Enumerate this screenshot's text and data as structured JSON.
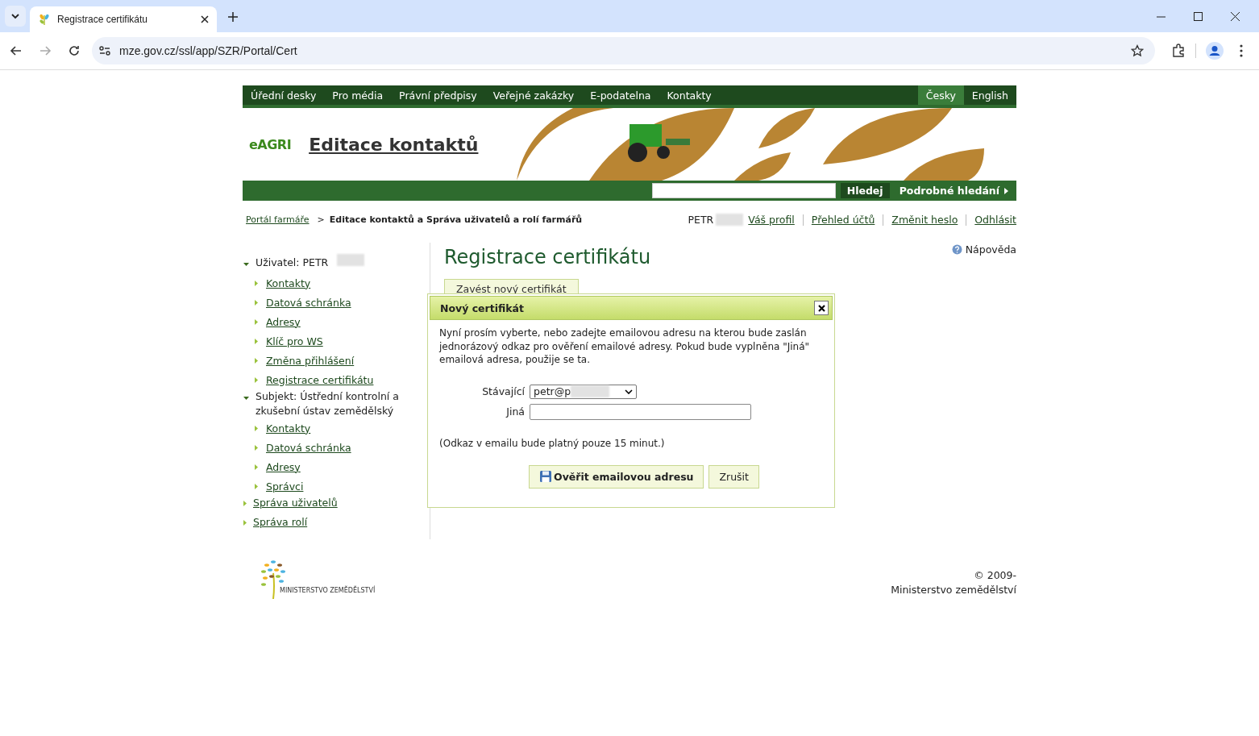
{
  "browser": {
    "tab_title": "Registrace certifikátu",
    "url": "mze.gov.cz/ssl/app/SZR/Portal/Cert"
  },
  "top_nav": [
    "Úřední desky",
    "Pro média",
    "Právní předpisy",
    "Veřejné zakázky",
    "E-podatelna",
    "Kontakty"
  ],
  "languages": [
    {
      "label": "Česky",
      "selected": true
    },
    {
      "label": "English",
      "selected": false
    }
  ],
  "header": {
    "logo": "eAGRI",
    "title": "Editace kontaktů"
  },
  "search": {
    "button": "Hledej",
    "advanced": "Podrobné hledání"
  },
  "breadcrumb_separator": ">",
  "breadcrumb": [
    {
      "label": "Portál farmáře",
      "link": true
    },
    {
      "label": "Editace kontaktů a Správa uživatelů a rolí farmářů",
      "link": false
    }
  ],
  "user_name": "PETR",
  "user_links": [
    "Váš profil",
    "Přehled účtů",
    "Změnit heslo",
    "Odhlásit"
  ],
  "sidebar": {
    "items": [
      {
        "label": "Uživatel: PETR",
        "kind": "header",
        "expanded": true,
        "redacted": true,
        "children": [
          {
            "label": "Kontakty"
          },
          {
            "label": "Datová schránka"
          },
          {
            "label": "Adresy"
          },
          {
            "label": "Klíč pro WS"
          },
          {
            "label": "Změna přihlášení"
          },
          {
            "label": "Registrace certifikátu"
          }
        ]
      },
      {
        "label": "Subjekt: Ústřední kontrolní a zkušební ústav zemědělský",
        "kind": "header",
        "expanded": true,
        "redacted": false,
        "children": [
          {
            "label": "Kontakty"
          },
          {
            "label": "Datová schránka"
          },
          {
            "label": "Adresy"
          },
          {
            "label": "Správci"
          }
        ]
      },
      {
        "label": "Správa uživatelů",
        "kind": "link",
        "expanded": false
      },
      {
        "label": "Správa rolí",
        "kind": "link",
        "expanded": false
      }
    ]
  },
  "page_title": "Registrace certifikátu",
  "help": "Nápověda",
  "new_cert_button": "Zavést nový certifikát",
  "dialog": {
    "title": "Nový certifikát",
    "text": "Nyní prosím vyberte, nebo zadejte emailovou adresu na kterou bude zaslán jednorázový odkaz pro ověření emailové adresy. Pokud bude vyplněna \"Jiná\" emailová adresa, použije se ta.",
    "existing_label": "Stávající",
    "existing_value": "petr@p",
    "other_label": "Jiná",
    "note": "(Odkaz v emailu bude platný pouze 15 minut.)",
    "confirm": "Ověřit emailovou adresu",
    "cancel": "Zrušit"
  },
  "footer": {
    "logo_text": "MINISTERSTVO ZEMĚDĚLSTVÍ",
    "copyright": "© 2009-",
    "org": "Ministerstvo zemědělství"
  }
}
